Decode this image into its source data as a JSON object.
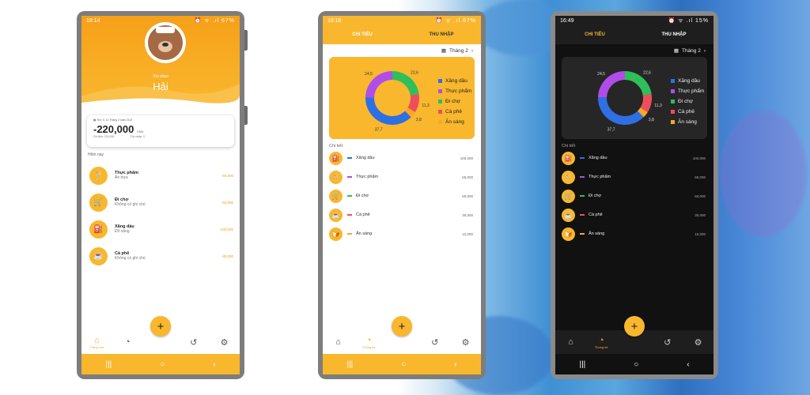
{
  "phone1": {
    "time": "18:14",
    "status_icons": "⏰ ᯤ .ıl 67%",
    "greeting": "Xin chào",
    "user_name": "Hải",
    "card_date": "Thứ 3, 13 Tháng 2 năm 2021",
    "card_amount": "-220,000",
    "card_currency": "VND",
    "card_spent": "Chi tiêu: 220,000",
    "card_income": "Thu nhập: 0",
    "today_label": "Hôm nay",
    "transactions": [
      {
        "title": "Thực phẩm",
        "note": "Ăn trưa",
        "amount": "-50,000",
        "icon": "food-icon"
      },
      {
        "title": "Đi chợ",
        "note": "Không có ghi chú",
        "amount": "-60,000",
        "icon": "basket-icon"
      },
      {
        "title": "Xăng dầu",
        "note": "Đổ xăng",
        "amount": "-100,000",
        "icon": "fuel-icon"
      },
      {
        "title": "Cà phê",
        "note": "Không có ghi chú",
        "amount": "-30,000",
        "icon": "coffee-icon"
      }
    ],
    "nav_home_label": "Trang chủ"
  },
  "phone2": {
    "time": "18:16",
    "status_icons": "⏰ ᯤ .ıl 67%",
    "nav_stats_label": "Thống kê"
  },
  "phone3": {
    "time": "16:49",
    "status_icons": "⏰ ᯤ .ıl 15%",
    "nav_stats_label": "Thống kê"
  },
  "tabs": {
    "expense": "CHI TIÊU",
    "income": "THU NHẬP"
  },
  "month_label": "Tháng 2",
  "detail_label": "Chi tiết",
  "fab_label": "+",
  "colors": {
    "accent": "#f9b72e",
    "fuel": "#2f6fe4",
    "food": "#b04de8",
    "market": "#2fbf5a",
    "coffee": "#ef4d5c",
    "breakfast": "#f9a825"
  },
  "chart_data": {
    "type": "pie",
    "categories": [
      "Xăng dầu",
      "Thực phẩm",
      "Đi chợ",
      "Cà phê",
      "Ăn sáng"
    ],
    "values": [
      37.7,
      24.5,
      22.6,
      11.3,
      3.8
    ],
    "value_labels": [
      "37,7",
      "24,5",
      "22,6",
      "11,3",
      "3,8"
    ],
    "legend_position": "right"
  },
  "details": [
    {
      "name": "Xăng dầu",
      "value": "100,000",
      "icon": "fuel-icon",
      "color": "#2f6fe4"
    },
    {
      "name": "Thực phẩm",
      "value": "65,000",
      "icon": "food-icon",
      "color": "#b04de8"
    },
    {
      "name": "Đi chợ",
      "value": "60,000",
      "icon": "basket-icon",
      "color": "#2fbf5a"
    },
    {
      "name": "Cà phê",
      "value": "30,000",
      "icon": "coffee-icon",
      "color": "#ef4d5c"
    },
    {
      "name": "Ăn sáng",
      "value": "10,000",
      "icon": "breakfast-icon",
      "color": "#f9a825"
    }
  ]
}
